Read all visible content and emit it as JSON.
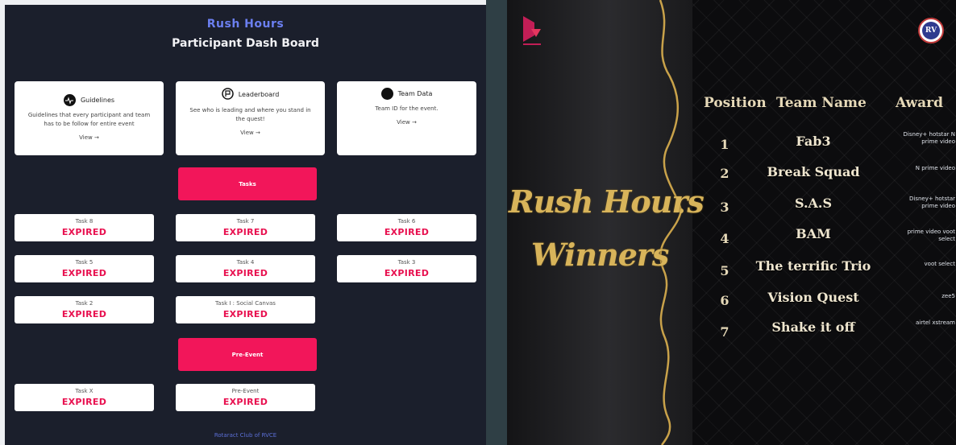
{
  "dashboard": {
    "title": "Rush Hours",
    "subtitle": "Participant Dash Board",
    "cards": [
      {
        "label": "Guidelines",
        "desc": "Guidelines that every participant and team has to be follow for entire event",
        "view": "View →"
      },
      {
        "label": "Leaderboard",
        "desc": "See who is leading and where you stand in the quest!",
        "view": "View →"
      },
      {
        "label": "Team Data",
        "desc": "Team ID for the event.",
        "view": "View →"
      }
    ],
    "tasks_button": "Tasks",
    "pre_event_button": "Pre-Event",
    "tasks": [
      {
        "name": "Task 8",
        "status": "EXPIRED"
      },
      {
        "name": "Task 7",
        "status": "EXPIRED"
      },
      {
        "name": "Task 6",
        "status": "EXPIRED"
      },
      {
        "name": "Task 5",
        "status": "EXPIRED"
      },
      {
        "name": "Task 4",
        "status": "EXPIRED"
      },
      {
        "name": "Task 3",
        "status": "EXPIRED"
      },
      {
        "name": "Task 2",
        "status": "EXPIRED"
      },
      {
        "name": "Task I : Social Canvas",
        "status": "EXPIRED"
      }
    ],
    "pre_event_tasks": [
      {
        "name": "Task X",
        "status": "EXPIRED"
      },
      {
        "name": "Pre-Event",
        "status": "EXPIRED"
      }
    ],
    "footer": "Rotaract Club of RVCE"
  },
  "winners": {
    "heading_line1": "Rush Hours",
    "heading_line2": "Winners",
    "columns": {
      "position": "Position",
      "team": "Team Name",
      "award": "Award"
    },
    "rows": [
      {
        "position": "1",
        "team": "Fab3",
        "award": "Disney+ hotstar N prime video"
      },
      {
        "position": "2",
        "team": "Break Squad",
        "award": "N prime video"
      },
      {
        "position": "3",
        "team": "S.A.S",
        "award": "Disney+ hotstar prime video"
      },
      {
        "position": "4",
        "team": "BAM",
        "award": "prime video voot select"
      },
      {
        "position": "5",
        "team": "The terrific Trio",
        "award": "voot select"
      },
      {
        "position": "6",
        "team": "Vision Quest",
        "award": "zee5"
      },
      {
        "position": "7",
        "team": "Shake it off",
        "award": "airtel xstream"
      }
    ],
    "rv_logo": "RV",
    "colors": {
      "gold": "#d8b45a",
      "accent": "#f2165a",
      "expired": "#e8104f"
    }
  }
}
